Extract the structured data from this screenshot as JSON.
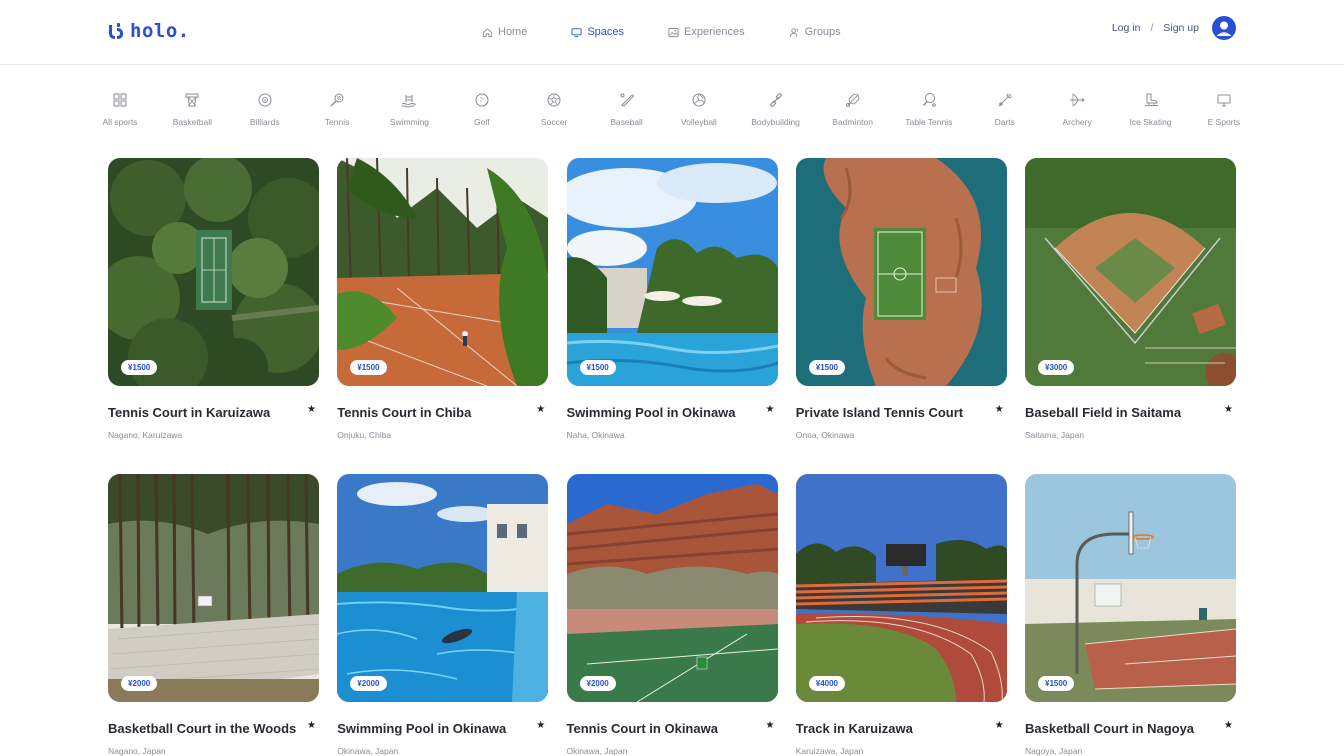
{
  "brand": {
    "name": "holo."
  },
  "nav": [
    {
      "label": "Home",
      "icon": "home-icon",
      "active": false
    },
    {
      "label": "Spaces",
      "icon": "monitor-icon",
      "active": true
    },
    {
      "label": "Experiences",
      "icon": "image-icon",
      "active": false
    },
    {
      "label": "Groups",
      "icon": "users-icon",
      "active": false
    }
  ],
  "auth": {
    "login": "Log in",
    "separator": "/",
    "signup": "Sign up"
  },
  "categories": [
    {
      "label": "All sports",
      "icon": "grid-icon"
    },
    {
      "label": "Basketball",
      "icon": "basketball-hoop-icon"
    },
    {
      "label": "Billiards",
      "icon": "billiard-ball-icon"
    },
    {
      "label": "Tennis",
      "icon": "tennis-racket-icon"
    },
    {
      "label": "Swimming",
      "icon": "swimmer-icon"
    },
    {
      "label": "Golf",
      "icon": "golf-ball-icon"
    },
    {
      "label": "Soccer",
      "icon": "soccer-ball-icon"
    },
    {
      "label": "Baseball",
      "icon": "baseball-bat-icon"
    },
    {
      "label": "Volleyball",
      "icon": "volleyball-icon"
    },
    {
      "label": "Bodybuilding",
      "icon": "dumbbell-icon"
    },
    {
      "label": "Badminton",
      "icon": "shuttlecock-icon"
    },
    {
      "label": "Table Tennis",
      "icon": "ping-pong-icon"
    },
    {
      "label": "Darts",
      "icon": "dart-icon"
    },
    {
      "label": "Archery",
      "icon": "bow-arrow-icon"
    },
    {
      "label": "Ice Skating",
      "icon": "ice-skate-icon"
    },
    {
      "label": "E Sports",
      "icon": "computer-icon"
    }
  ],
  "listings": [
    {
      "title": "Tennis Court in Karuizawa",
      "location": "Nagano, Karuizawa",
      "price": "¥1500",
      "scene": "forest-court"
    },
    {
      "title": "Tennis Court in Chiba",
      "location": "Onjuku, Chiba",
      "price": "¥1500",
      "scene": "clay-court"
    },
    {
      "title": "Swimming Pool in Okinawa",
      "location": "Naha, Okinawa",
      "price": "¥1500",
      "scene": "resort-pool"
    },
    {
      "title": "Private Island Tennis Court",
      "location": "Onna, Okinawa",
      "price": "¥1500",
      "scene": "island-field"
    },
    {
      "title": "Baseball Field in Saitama",
      "location": "Saitama, Japan",
      "price": "¥3000",
      "scene": "baseball-field"
    },
    {
      "title": "Basketball Court in the Woods",
      "location": "Nagano, Japan",
      "price": "¥2000",
      "scene": "woods-court"
    },
    {
      "title": "Swimming Pool in Okinawa",
      "location": "Okinawa, Japan",
      "price": "¥2000",
      "scene": "underwater-pool"
    },
    {
      "title": "Tennis Court in Okinawa",
      "location": "Okinawa, Japan",
      "price": "¥2000",
      "scene": "canyon-court"
    },
    {
      "title": "Track in Karuizawa",
      "location": "Karuizawa, Japan",
      "price": "¥4000",
      "scene": "stadium-track"
    },
    {
      "title": "Basketball Court in Nagoya",
      "location": "Nagoya, Japan",
      "price": "¥1500",
      "scene": "outdoor-hoop"
    }
  ],
  "colors": {
    "accent": "#2b4fd4",
    "muted": "#8a8d99",
    "title": "#2a2a33"
  }
}
